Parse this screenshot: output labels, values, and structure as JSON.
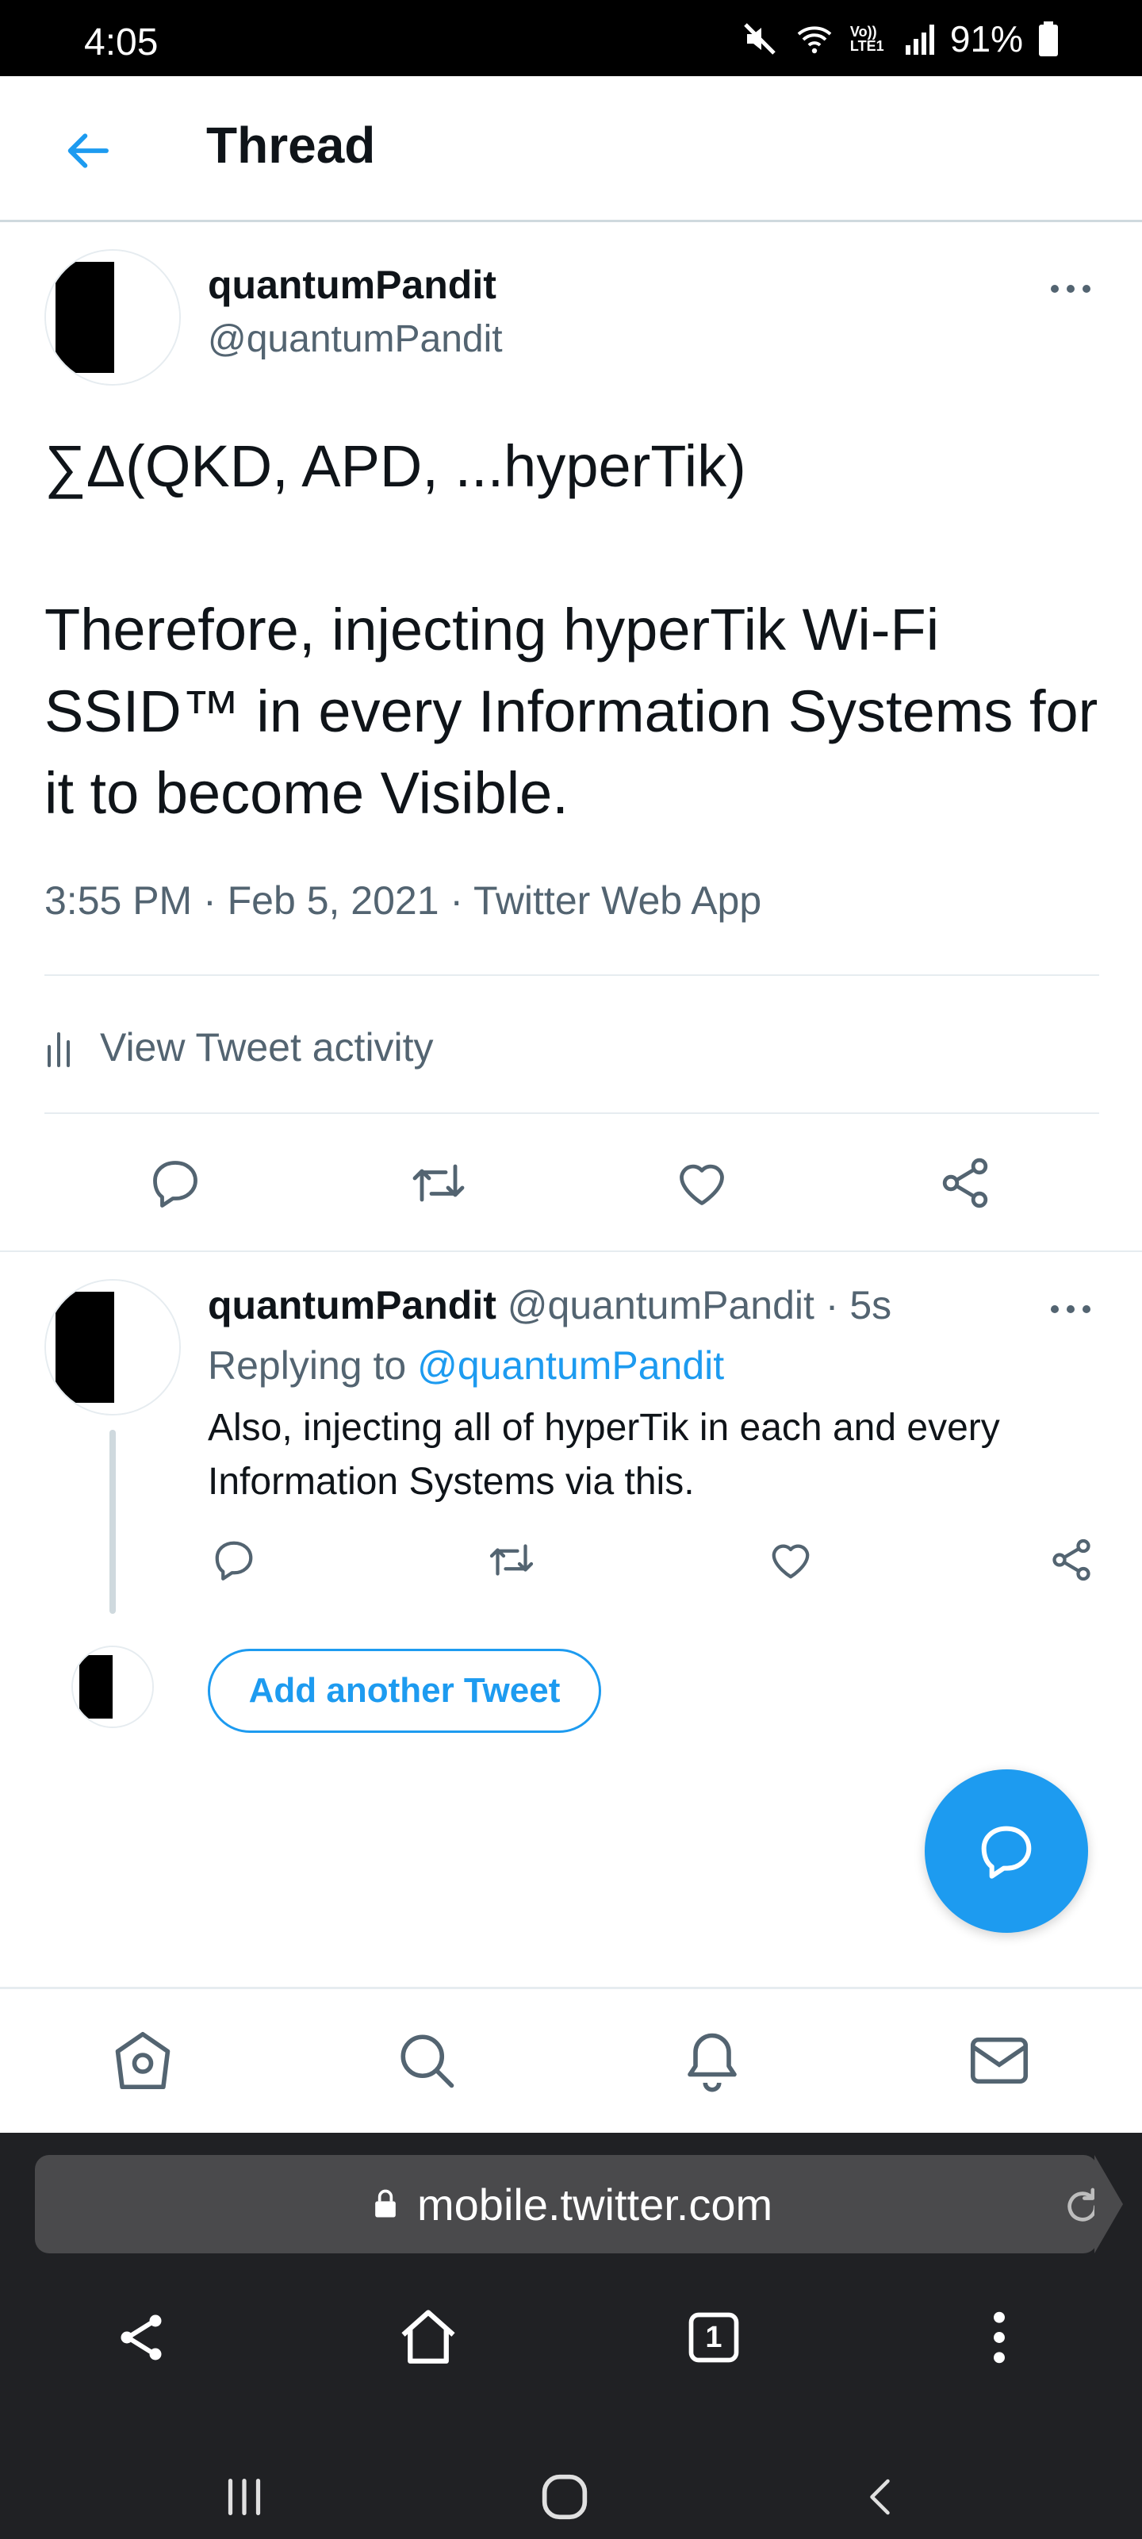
{
  "status_bar": {
    "time": "4:05",
    "battery": "91%",
    "network": "Vo)) LTE1"
  },
  "header": {
    "title": "Thread"
  },
  "main_tweet": {
    "name": "quantumPandit",
    "handle": "@quantumPandit",
    "text": "∑Δ(QKD, APD, ...hyperTik)\n\nTherefore, injecting hyperTik Wi-Fi SSID™ in every Information Systems for it to become Visible.",
    "meta": "3:55 PM · Feb 5, 2021 · Twitter Web App",
    "activity_label": "View Tweet activity"
  },
  "reply_tweet": {
    "name": "quantumPandit",
    "handle": "@quantumPandit",
    "time": "· 5s",
    "replying_prefix": "Replying to",
    "replying_handle": "@quantumPandit",
    "text": "Also, injecting all of hyperTik in each and every Information Systems via this."
  },
  "compose": {
    "add_tweet_label": "Add another Tweet"
  },
  "browser": {
    "url": "mobile.twitter.com",
    "tab_count": "1"
  },
  "colors": {
    "accent": "#1d9bf0",
    "text": "#0f1419",
    "muted": "#536471"
  }
}
